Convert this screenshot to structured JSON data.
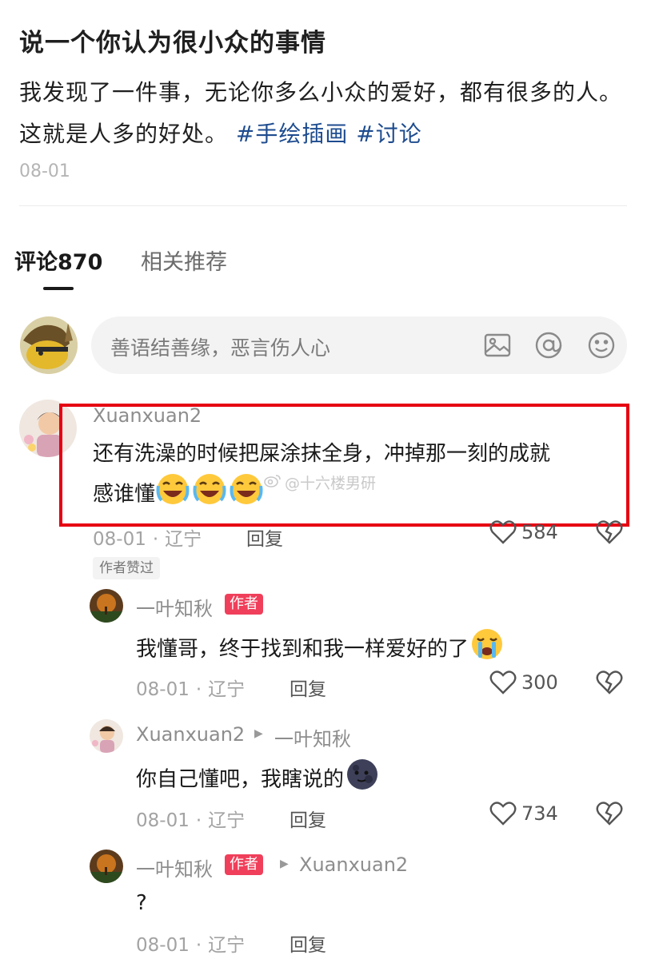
{
  "post": {
    "title": "说一个你认为很小众的事情",
    "body": "我发现了一件事，无论你多么小众的爱好，都有很多的人。这就是人多的好处。",
    "hashtags": [
      "#手绘插画",
      "#讨论"
    ],
    "date": "08-01"
  },
  "tabs": {
    "comments": "评论870",
    "related": "相关推荐"
  },
  "comment_input": {
    "placeholder": "善语结善缘，恶言伤人心",
    "icons": [
      "image-icon",
      "at-icon",
      "emoji-icon"
    ]
  },
  "comments": [
    {
      "user": "Xuanxuan2",
      "text_line1": "还有洗澡的时候把屎涂抹全身，冲掉那一刻的成就",
      "text_line2": "感谁懂",
      "date": "08-01",
      "location": "辽宁",
      "reply": "回复",
      "likes": "584",
      "tag": "作者赞过",
      "replies": [
        {
          "user": "一叶知秋",
          "badge": "作者",
          "text": "我懂哥，终于找到和我一样爱好的了",
          "date": "08-01",
          "location": "辽宁",
          "reply": "回复",
          "likes": "300"
        },
        {
          "user": "Xuanxuan2",
          "reply_to": "一叶知秋",
          "text": "你自己懂吧，我瞎说的",
          "date": "08-01",
          "location": "辽宁",
          "reply": "回复",
          "likes": "734"
        },
        {
          "user": "一叶知秋",
          "badge": "作者",
          "reply_to": "Xuanxuan2",
          "text": "?",
          "date": "08-01",
          "location": "辽宁",
          "reply": "回复"
        }
      ]
    }
  ],
  "watermark": "@十六楼男研",
  "colors": {
    "hashtag": "#1e4c8f",
    "author_badge": "#f03f5a",
    "highlight": "#e60012"
  }
}
